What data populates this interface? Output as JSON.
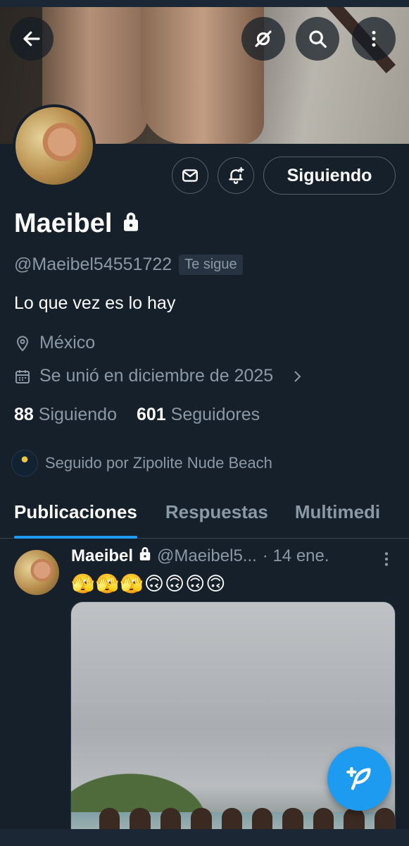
{
  "profile": {
    "name": "Maeibel",
    "handle": "@Maeibel54551722",
    "follows_you": "Te sigue",
    "bio": "Lo que vez es lo hay",
    "location": "México",
    "joined": "Se unió en diciembre de 2025",
    "following_count": "88",
    "following_label": "Siguiendo",
    "followers_count": "601",
    "followers_label": "Seguidores",
    "followed_by": "Seguido por Zipolite Nude Beach"
  },
  "actions": {
    "follow_button": "Siguiendo"
  },
  "tabs": [
    {
      "label": "Publicaciones",
      "active": true
    },
    {
      "label": "Respuestas",
      "active": false
    },
    {
      "label": "Multimedi",
      "active": false
    }
  ],
  "post": {
    "name": "Maeibel",
    "handle": "@Maeibel5...",
    "date": "· 14 ene.",
    "text": "🫣🫣🫣🙃🙃🙃🙃"
  },
  "colors": {
    "background": "#15202b",
    "accent": "#1d9bf0",
    "muted": "#8b98a5"
  }
}
